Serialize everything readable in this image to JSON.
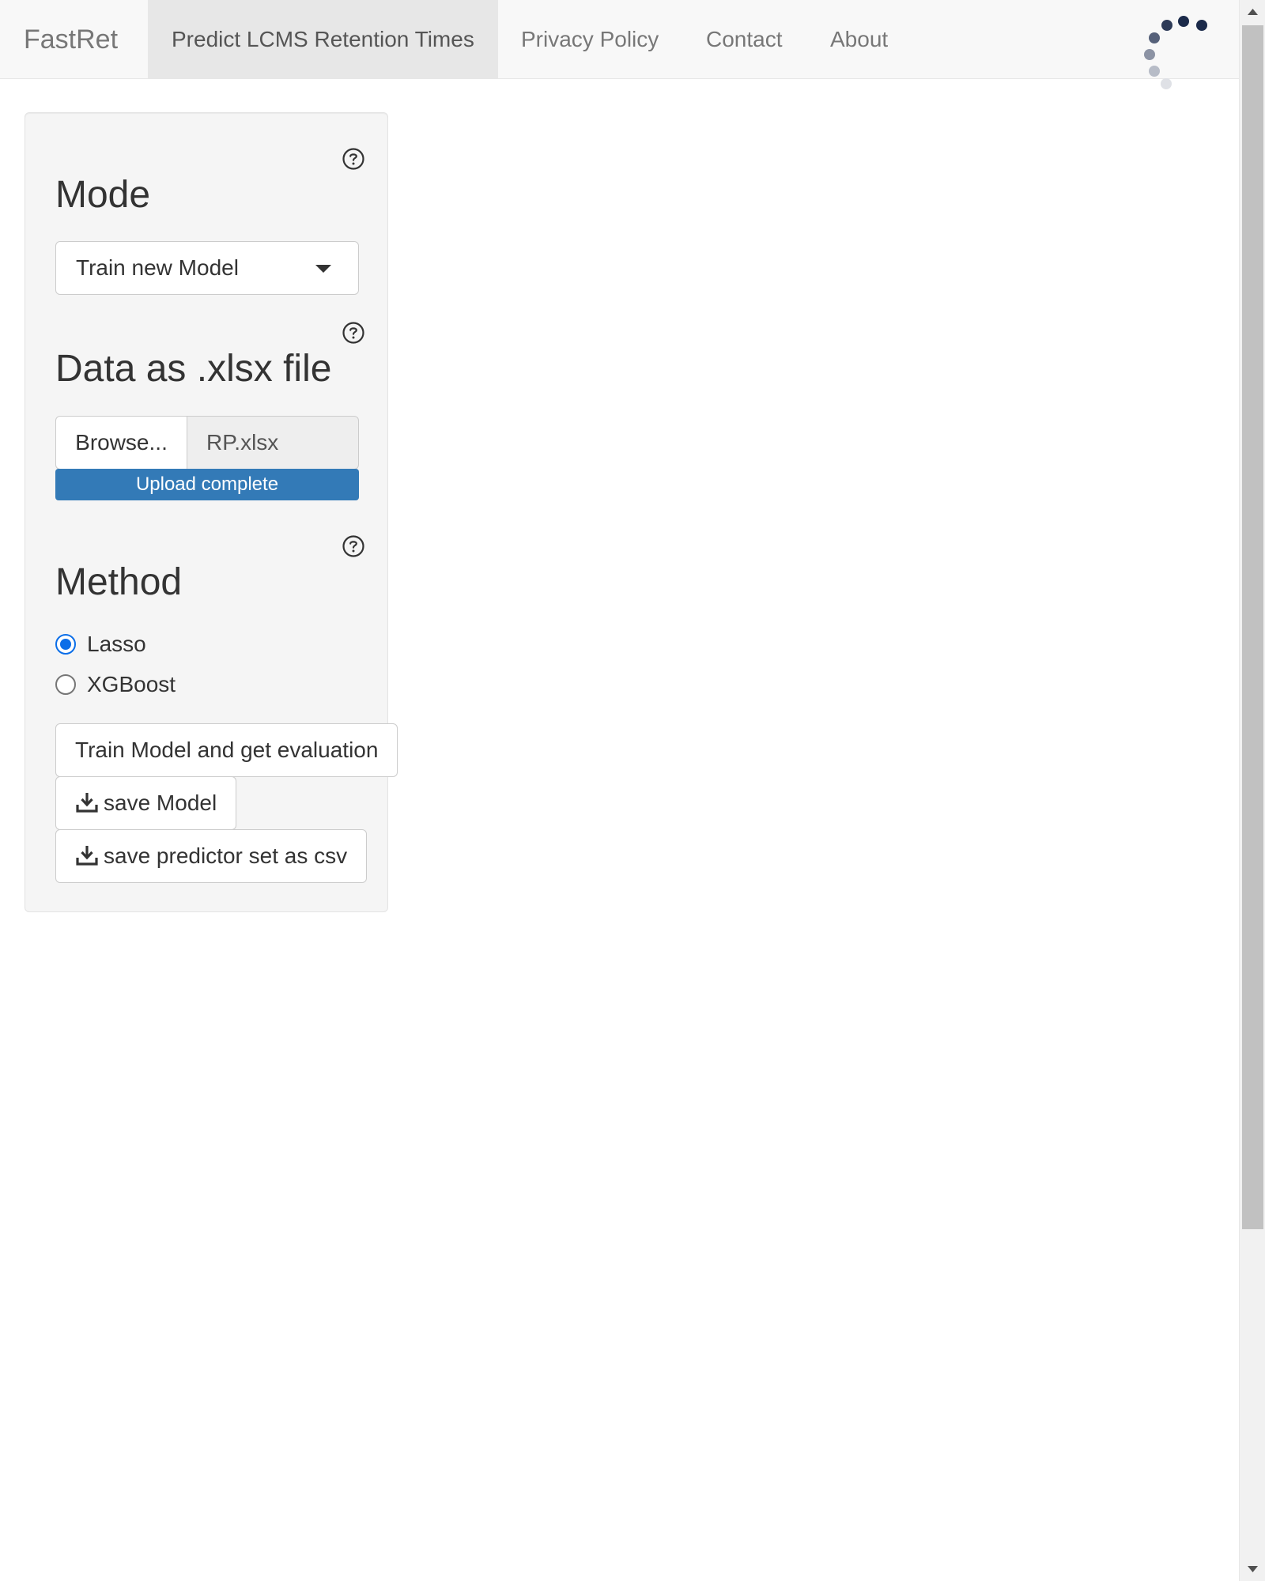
{
  "navbar": {
    "brand": "FastRet",
    "items": [
      {
        "label": "Predict LCMS Retention Times",
        "active": true
      },
      {
        "label": "Privacy Policy",
        "active": false
      },
      {
        "label": "Contact",
        "active": false
      },
      {
        "label": "About",
        "active": false
      }
    ],
    "loading_icon": "busy-spinner-icon"
  },
  "sidebar": {
    "mode": {
      "title": "Mode",
      "help_icon": "question-circle-icon",
      "selected": "Train new Model"
    },
    "data_file": {
      "title": "Data as .xlsx file",
      "help_icon": "question-circle-icon",
      "browse_label": "Browse...",
      "file_name": "RP.xlsx",
      "progress_label": "Upload complete",
      "progress_fraction": 1.0
    },
    "method": {
      "title": "Method",
      "help_icon": "question-circle-icon",
      "options": [
        {
          "label": "Lasso",
          "checked": true
        },
        {
          "label": "XGBoost",
          "checked": false
        }
      ]
    },
    "buttons": {
      "train": "Train Model and get evaluation",
      "save_model": "save Model",
      "save_predictors": "save predictor set as csv",
      "download_icon": "download-icon"
    }
  },
  "colors": {
    "navbar_bg": "#f8f8f8",
    "active_tab_bg": "#e7e7e7",
    "panel_bg": "#f5f5f5",
    "progress_bar": "#337ab7",
    "radio_checked": "#0b6ee8",
    "spinner_dark": "#1b2a4a"
  }
}
